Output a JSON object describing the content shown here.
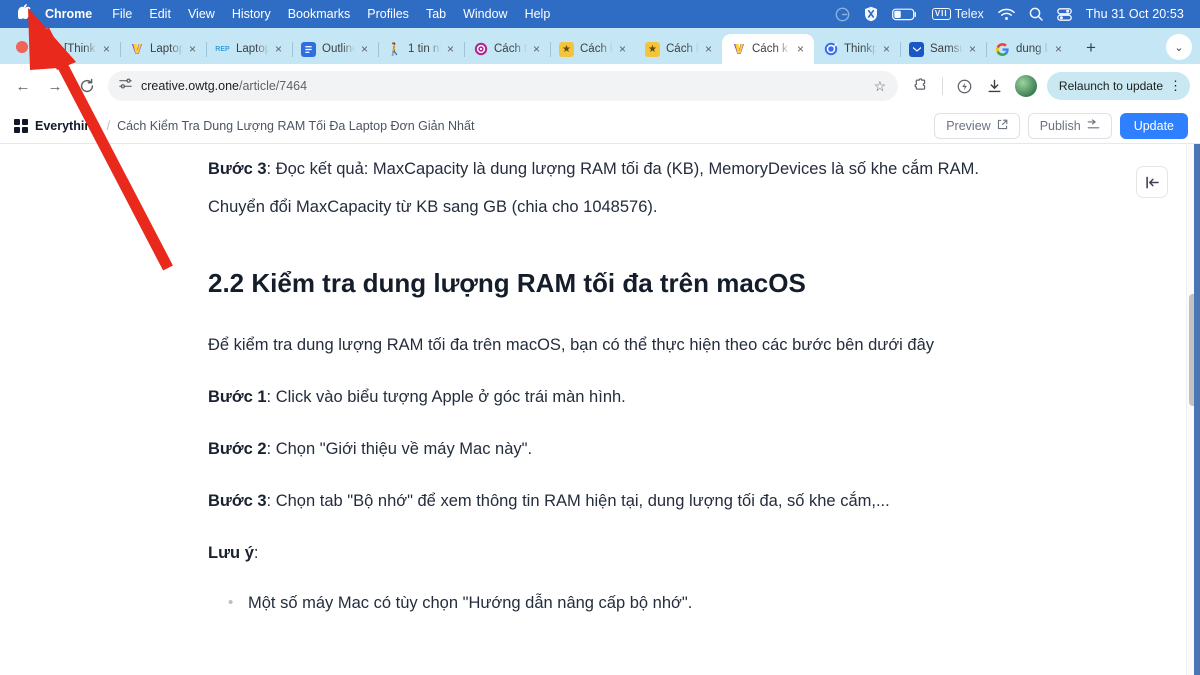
{
  "menubar": {
    "apple_glyph": "",
    "items": [
      {
        "label": "Chrome",
        "bold": true
      },
      {
        "label": "File",
        "bold": false
      },
      {
        "label": "Edit",
        "bold": false
      },
      {
        "label": "View",
        "bold": false
      },
      {
        "label": "History",
        "bold": false
      },
      {
        "label": "Bookmarks",
        "bold": false
      },
      {
        "label": "Profiles",
        "bold": false
      },
      {
        "label": "Tab",
        "bold": false
      },
      {
        "label": "Window",
        "bold": false
      },
      {
        "label": "Help",
        "bold": false
      }
    ],
    "tray": {
      "telex_label": "Telex",
      "telex_badge": "VII"
    },
    "clock": "Thu 31 Oct  20:53"
  },
  "tabstrip": {
    "tabs": [
      {
        "label": "[Think",
        "favicon": "notion-icon",
        "active": false
      },
      {
        "label": "Laptop",
        "favicon": "v-icon",
        "active": false
      },
      {
        "label": "Laptop",
        "favicon": "rep-icon",
        "active": false
      },
      {
        "label": "Outline",
        "favicon": "doc-icon",
        "active": false
      },
      {
        "label": "1 tin nh",
        "favicon": "runner-icon",
        "active": false
      },
      {
        "label": "Cách t",
        "favicon": "at-icon",
        "active": false
      },
      {
        "label": "Cách k",
        "favicon": "star-icon",
        "active": false
      },
      {
        "label": "Cách k",
        "favicon": "star-icon",
        "active": false
      },
      {
        "label": "Cách k",
        "favicon": "v-icon",
        "active": true
      },
      {
        "label": "Thinkp",
        "favicon": "c-icon",
        "active": false
      },
      {
        "label": "Samsu",
        "favicon": "samsung-icon",
        "active": false
      },
      {
        "label": "dung l",
        "favicon": "google-icon",
        "active": false
      }
    ],
    "new_tab_label": "+",
    "tab_close_label": "×",
    "tab_list_chevron": "⌄"
  },
  "toolbar": {
    "back_label": "←",
    "forward_label": "→",
    "reload_label": "↻",
    "url_primary": "creative.owtg.one",
    "url_secondary": "/article/7464",
    "bookmark_label": "☆",
    "extensions_label": "extensions-icon",
    "performance_label": "performance-icon",
    "downloads_label": "downloads-icon",
    "profile_label": "profile-avatar",
    "relaunch_label": "Relaunch to update",
    "menu_dots": "⋮"
  },
  "appheader": {
    "root_crumb": "Everything",
    "separator": "/",
    "current_crumb": "Cách Kiểm Tra Dung Lượng RAM Tối Đa Laptop Đơn Giản Nhất",
    "preview_label": "Preview",
    "preview_icon": "↗",
    "publish_label": "Publish",
    "publish_icon": "⤳",
    "update_label": "Update"
  },
  "panel": {
    "collapse_icon": "|←"
  },
  "article": {
    "blocks": [
      {
        "type": "paragraph",
        "lead": "Bước 3",
        "text": ": Đọc kết quả: MaxCapacity là dung lượng RAM tối đa (KB), MemoryDevices là số khe cắm RAM. Chuyển đổi MaxCapacity từ KB sang GB (chia cho 1048576)."
      },
      {
        "type": "heading",
        "text": "2.2 Kiểm tra dung lượng RAM tối đa trên macOS"
      },
      {
        "type": "paragraph",
        "lead": "",
        "text": "Để kiểm tra dung lượng RAM tối đa trên macOS, bạn có thể thực hiện theo các bước bên dưới đây"
      },
      {
        "type": "paragraph",
        "lead": "Bước 1",
        "text": ": Click vào biểu tượng Apple ở góc trái màn hình."
      },
      {
        "type": "paragraph",
        "lead": "Bước 2",
        "text": ": Chọn \"Giới thiệu về máy Mac này\"."
      },
      {
        "type": "paragraph",
        "lead": "Bước 3",
        "text": ": Chọn tab \"Bộ nhớ\" để xem thông tin RAM hiện tại, dung lượng tối đa, số khe cắm,..."
      },
      {
        "type": "paragraph",
        "lead": "Lưu ý",
        "text": ":"
      }
    ],
    "bullets": [
      "Một số máy Mac có tùy chọn \"Hướng dẫn nâng cấp bộ nhớ\"."
    ]
  },
  "annotation": {
    "type": "arrow",
    "color": "#e8291c",
    "points_to": "apple-menu-icon"
  },
  "colors": {
    "menubar_bg": "#2f6cc4",
    "tabstrip_bg": "#c5e7f5",
    "accent_blue": "#2f80ff",
    "relaunch_bg": "#c9e8f2",
    "arrow_red": "#e8291c"
  }
}
